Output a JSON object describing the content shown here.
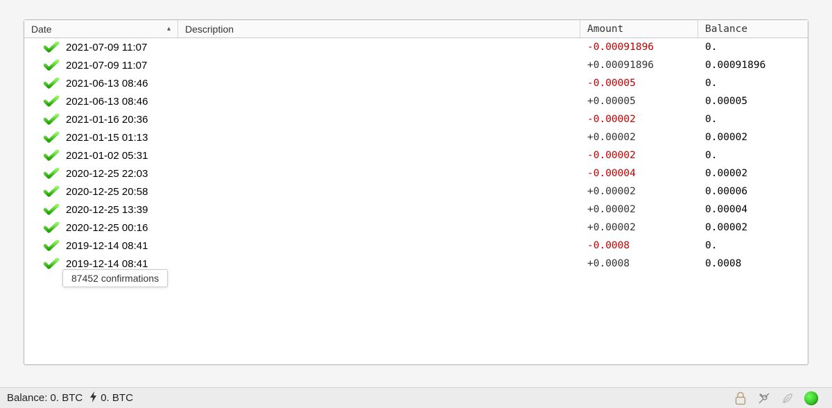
{
  "columns": {
    "date": "Date",
    "description": "Description",
    "amount": "Amount",
    "balance": "Balance"
  },
  "sort_indicator": "▴",
  "transactions": [
    {
      "date": "2021-07-09 11:07",
      "description": "",
      "amount": "-0.00091896",
      "balance": "0.",
      "neg": true
    },
    {
      "date": "2021-07-09 11:07",
      "description": "",
      "amount": "+0.00091896",
      "balance": "0.00091896",
      "neg": false
    },
    {
      "date": "2021-06-13 08:46",
      "description": "",
      "amount": "-0.00005",
      "balance": "0.",
      "neg": true
    },
    {
      "date": "2021-06-13 08:46",
      "description": "",
      "amount": "+0.00005",
      "balance": "0.00005",
      "neg": false
    },
    {
      "date": "2021-01-16 20:36",
      "description": "",
      "amount": "-0.00002",
      "balance": "0.",
      "neg": true
    },
    {
      "date": "2021-01-15 01:13",
      "description": "",
      "amount": "+0.00002",
      "balance": "0.00002",
      "neg": false
    },
    {
      "date": "2021-01-02 05:31",
      "description": "",
      "amount": "-0.00002",
      "balance": "0.",
      "neg": true
    },
    {
      "date": "2020-12-25 22:03",
      "description": "",
      "amount": "-0.00004",
      "balance": "0.00002",
      "neg": true
    },
    {
      "date": "2020-12-25 20:58",
      "description": "",
      "amount": "+0.00002",
      "balance": "0.00006",
      "neg": false
    },
    {
      "date": "2020-12-25 13:39",
      "description": "",
      "amount": "+0.00002",
      "balance": "0.00004",
      "neg": false
    },
    {
      "date": "2020-12-25 00:16",
      "description": "",
      "amount": "+0.00002",
      "balance": "0.00002",
      "neg": false
    },
    {
      "date": "2019-12-14 08:41",
      "description": "",
      "amount": "-0.0008",
      "balance": "0.",
      "neg": true
    },
    {
      "date": "2019-12-14 08:41",
      "description": "",
      "amount": "+0.0008",
      "balance": "0.0008",
      "neg": false
    }
  ],
  "tooltip": "87452 confirmations",
  "statusbar": {
    "balance_label": "Balance: 0. BTC",
    "lightning_label": "0. BTC"
  },
  "icons": {
    "confirmed": "check-icon",
    "lock": "lock-icon",
    "tools": "tools-icon",
    "seed": "seed-icon",
    "network": "network-status-dot"
  }
}
